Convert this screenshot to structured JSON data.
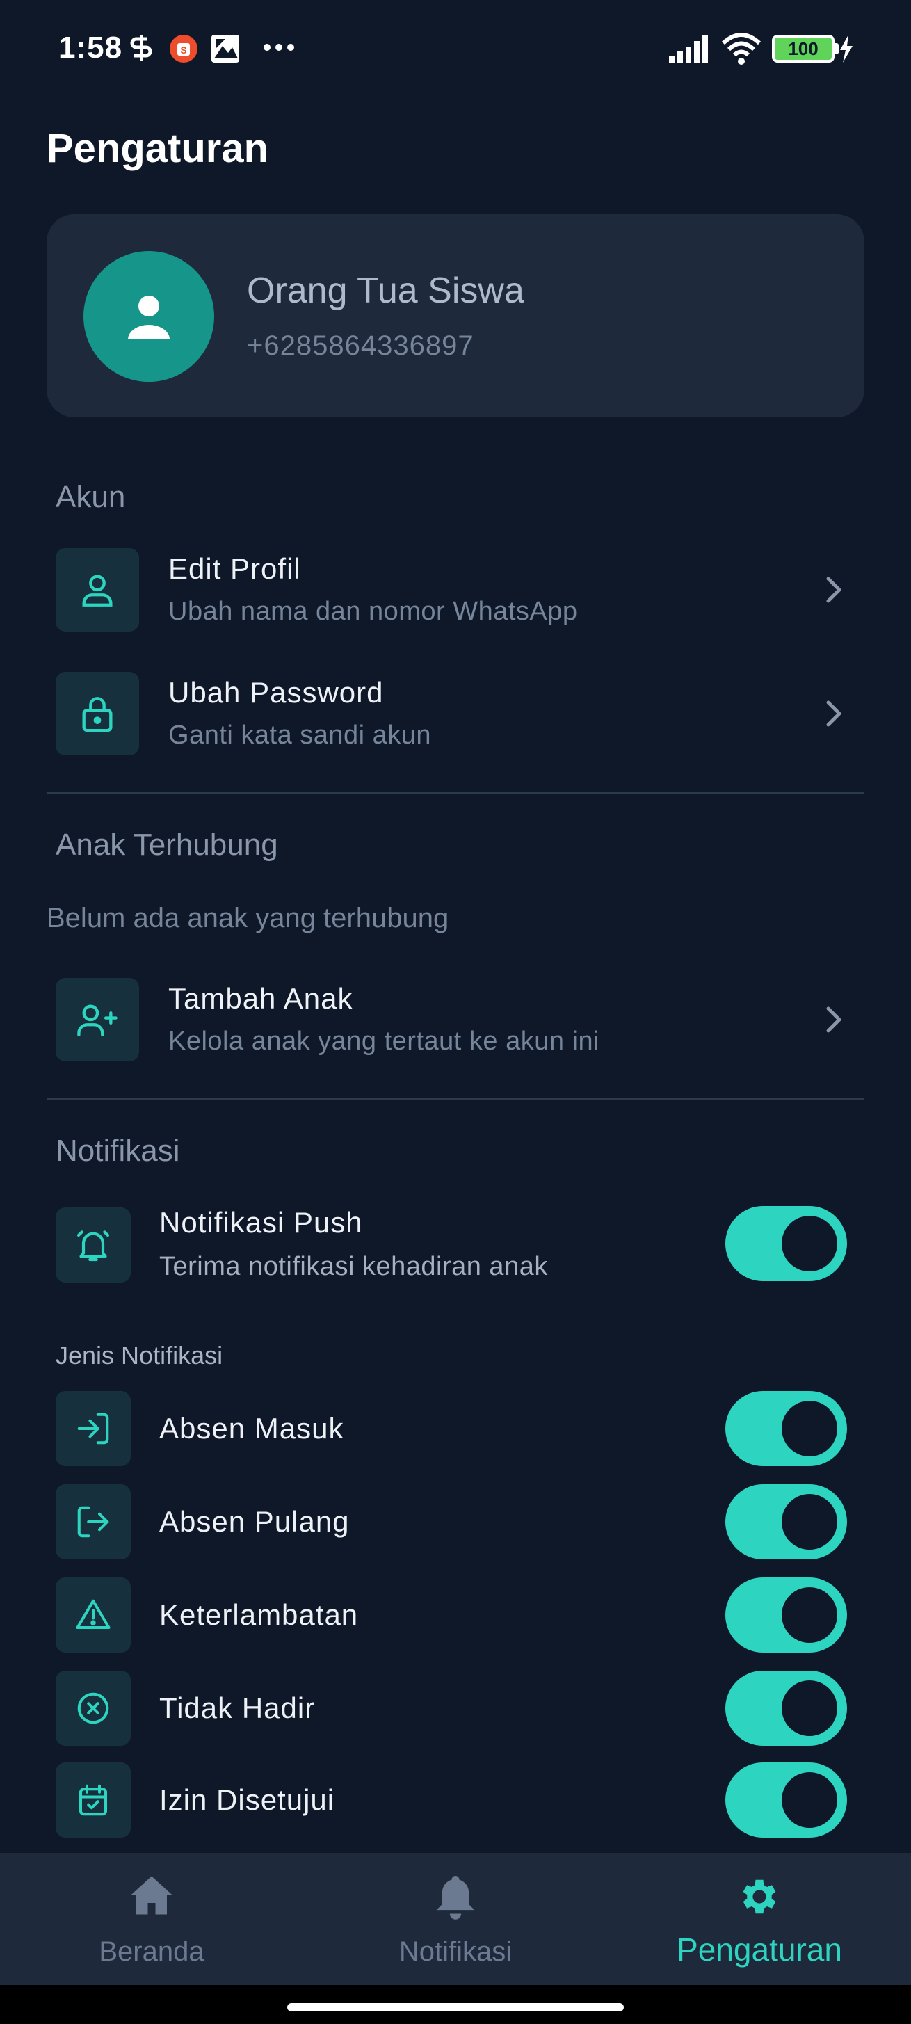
{
  "status_bar": {
    "time": "1:58",
    "battery": "100"
  },
  "header": {
    "title": "Pengaturan"
  },
  "profile": {
    "name": "Orang Tua Siswa",
    "phone": "+6285864336897"
  },
  "sections": {
    "account": {
      "title": "Akun",
      "items": [
        {
          "title": "Edit Profil",
          "subtitle": "Ubah nama dan nomor WhatsApp",
          "icon": "user-icon"
        },
        {
          "title": "Ubah Password",
          "subtitle": "Ganti kata sandi akun",
          "icon": "lock-icon"
        }
      ]
    },
    "children": {
      "title": "Anak Terhubung",
      "empty_note": "Belum ada anak yang terhubung",
      "items": [
        {
          "title": "Tambah Anak",
          "subtitle": "Kelola anak yang tertaut ke akun ini",
          "icon": "user-plus-icon"
        }
      ]
    },
    "notifications": {
      "title": "Notifikasi",
      "push": {
        "title": "Notifikasi Push",
        "subtitle": "Terima notifikasi kehadiran anak",
        "enabled": true,
        "icon": "bell-ring-icon"
      },
      "types_title": "Jenis Notifikasi",
      "types": [
        {
          "title": "Absen Masuk",
          "enabled": true,
          "icon": "log-in-icon"
        },
        {
          "title": "Absen Pulang",
          "enabled": true,
          "icon": "log-out-icon"
        },
        {
          "title": "Keterlambatan",
          "enabled": true,
          "icon": "warning-icon"
        },
        {
          "title": "Tidak Hadir",
          "enabled": true,
          "icon": "x-circle-icon"
        },
        {
          "title": "Izin Disetujui",
          "enabled": true,
          "icon": "calendar-check-icon"
        }
      ]
    }
  },
  "bottom_nav": {
    "items": [
      {
        "label": "Beranda",
        "icon": "home-icon"
      },
      {
        "label": "Notifikasi",
        "icon": "bell-icon"
      },
      {
        "label": "Pengaturan",
        "icon": "gear-icon"
      }
    ],
    "active": "Pengaturan"
  },
  "colors": {
    "background": "#0f1829",
    "card": "#1e293b",
    "accent": "#2dd4bf",
    "avatar": "#16968a",
    "icon_box": "#16313d"
  }
}
